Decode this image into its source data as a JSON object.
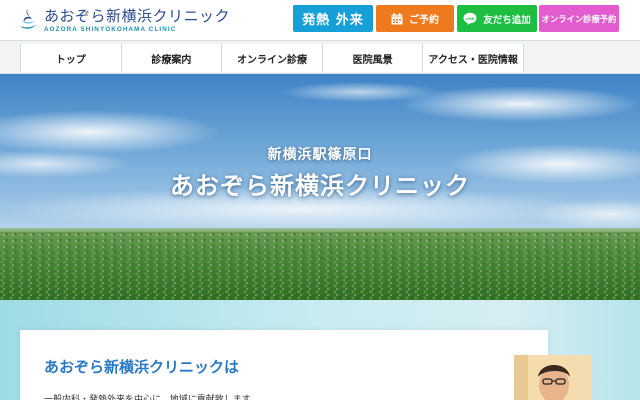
{
  "header": {
    "logo_jp": "あおぞら新横浜クリニック",
    "logo_en": "AOZORA SHINYOKOHAMA CLINIC",
    "buttons": {
      "fever": "発熱 外来",
      "reserve": "ご予約",
      "line": "友だち追加",
      "online": "オンライン診療予約"
    }
  },
  "nav": {
    "items": [
      "トップ",
      "診療案内",
      "オンライン診療",
      "医院風景",
      "アクセス・医院情報"
    ]
  },
  "hero": {
    "subtitle": "新横浜駅篠原口",
    "title": "あおぞら新横浜クリニック"
  },
  "intro": {
    "title": "あおぞら新横浜クリニックは",
    "text": "一般内科・発熱外来を中心に、地域に貢献致します"
  },
  "colors": {
    "fever": "#17a0d8",
    "reserve": "#ef7a1e",
    "line": "#1ebe43",
    "online": "#e25cd0",
    "accent": "#2a79c4"
  },
  "icons": [
    "clinic-logo-icon",
    "calendar-icon",
    "line-chat-icon"
  ]
}
